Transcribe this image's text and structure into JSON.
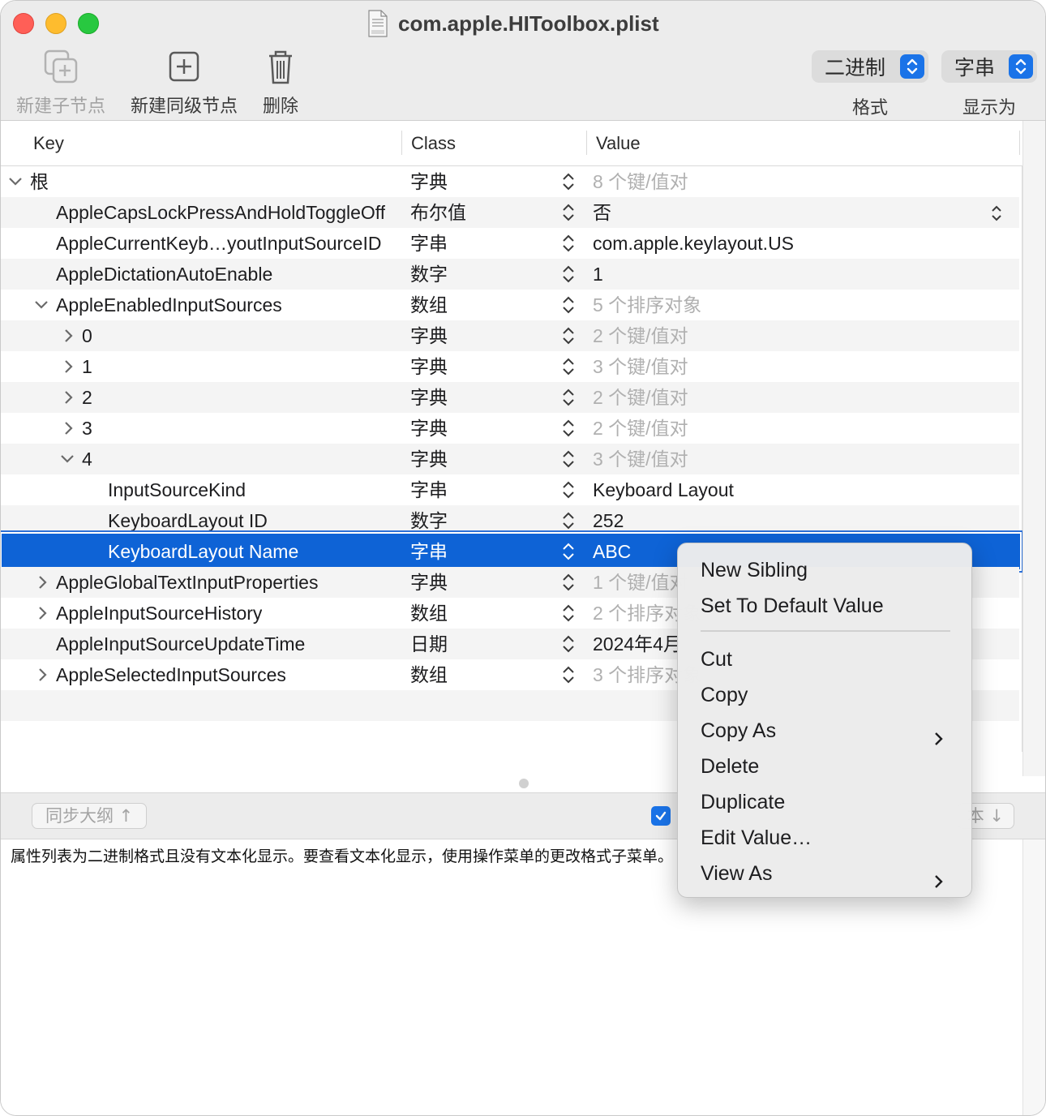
{
  "window": {
    "title": "com.apple.HIToolbox.plist"
  },
  "toolbar": {
    "new_child_label": "新建子节点",
    "new_sibling_label": "新建同级节点",
    "delete_label": "删除",
    "format_value": "二进制",
    "format_label": "格式",
    "display_value": "字串",
    "display_label": "显示为"
  },
  "columns": {
    "key": "Key",
    "class": "Class",
    "value": "Value"
  },
  "rows": [
    {
      "key": "根",
      "class": "字典",
      "value": "8 个键/值对"
    },
    {
      "key": "AppleCapsLockPressAndHoldToggleOff",
      "class": "布尔值",
      "value": "否"
    },
    {
      "key": "AppleCurrentKeyb…youtInputSourceID",
      "class": "字串",
      "value": "com.apple.keylayout.US"
    },
    {
      "key": "AppleDictationAutoEnable",
      "class": "数字",
      "value": "1"
    },
    {
      "key": "AppleEnabledInputSources",
      "class": "数组",
      "value": "5 个排序对象"
    },
    {
      "key": "0",
      "class": "字典",
      "value": "2 个键/值对"
    },
    {
      "key": "1",
      "class": "字典",
      "value": "3 个键/值对"
    },
    {
      "key": "2",
      "class": "字典",
      "value": "2 个键/值对"
    },
    {
      "key": "3",
      "class": "字典",
      "value": "2 个键/值对"
    },
    {
      "key": "4",
      "class": "字典",
      "value": "3 个键/值对"
    },
    {
      "key": "InputSourceKind",
      "class": "字串",
      "value": "Keyboard Layout"
    },
    {
      "key": "KeyboardLayout ID",
      "class": "数字",
      "value": "252"
    },
    {
      "key": "KeyboardLayout Name",
      "class": "字串",
      "value": "ABC"
    },
    {
      "key": "AppleGlobalTextInputProperties",
      "class": "字典",
      "value": "1 个键/值对"
    },
    {
      "key": "AppleInputSourceHistory",
      "class": "数组",
      "value": "2 个排序对象"
    },
    {
      "key": "AppleInputSourceUpdateTime",
      "class": "日期",
      "value": "2024年4月"
    },
    {
      "key": "AppleSelectedInputSources",
      "class": "数组",
      "value": "3 个排序对象"
    }
  ],
  "bottom": {
    "sync_label": "同步大纲 ↑",
    "right_button_label": "本 ↓",
    "message": "属性列表为二进制格式且没有文本化显示。要查看文本化显示，使用操作菜单的更改格式子菜单。"
  },
  "context_menu": {
    "items": [
      "New Sibling",
      "Set To Default Value",
      "Cut",
      "Copy",
      "Copy As",
      "Delete",
      "Duplicate",
      "Edit Value…",
      "View As"
    ]
  }
}
